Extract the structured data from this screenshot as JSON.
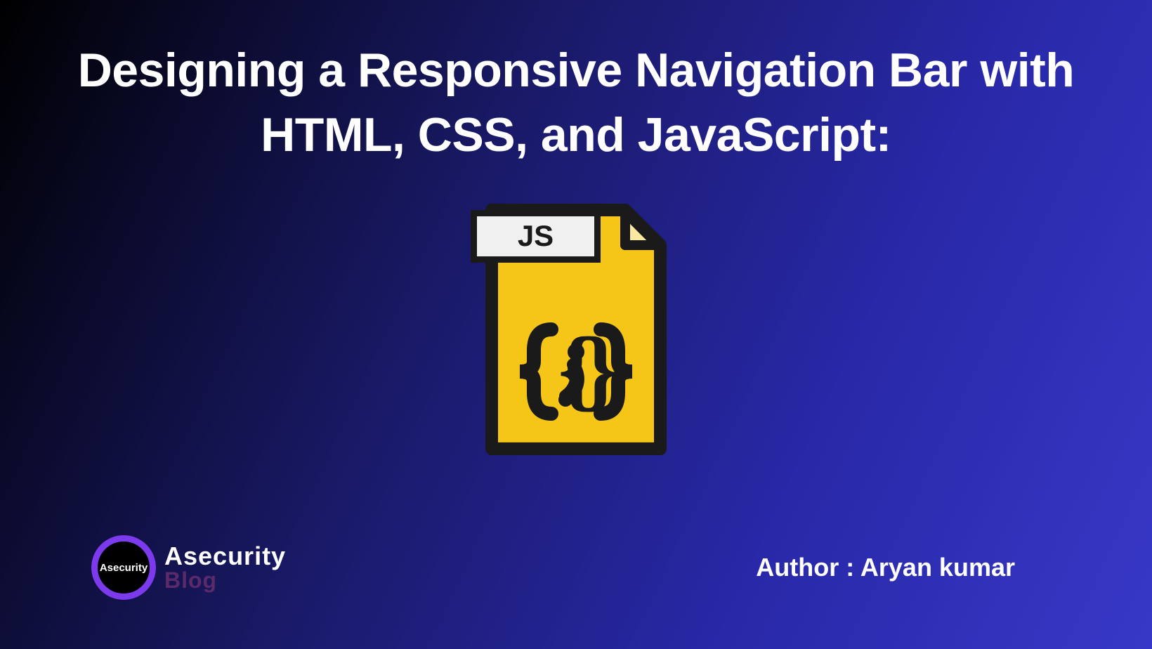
{
  "title": "Designing a Responsive Navigation Bar with HTML, CSS, and JavaScript:",
  "icon": {
    "label": "JS",
    "braces": "{ ; }"
  },
  "logo": {
    "circle_text": "Asecurity",
    "text_top": "Asecurity",
    "text_bottom": "Blog"
  },
  "author": {
    "label": "Author :",
    "name": "Aryan kumar"
  }
}
